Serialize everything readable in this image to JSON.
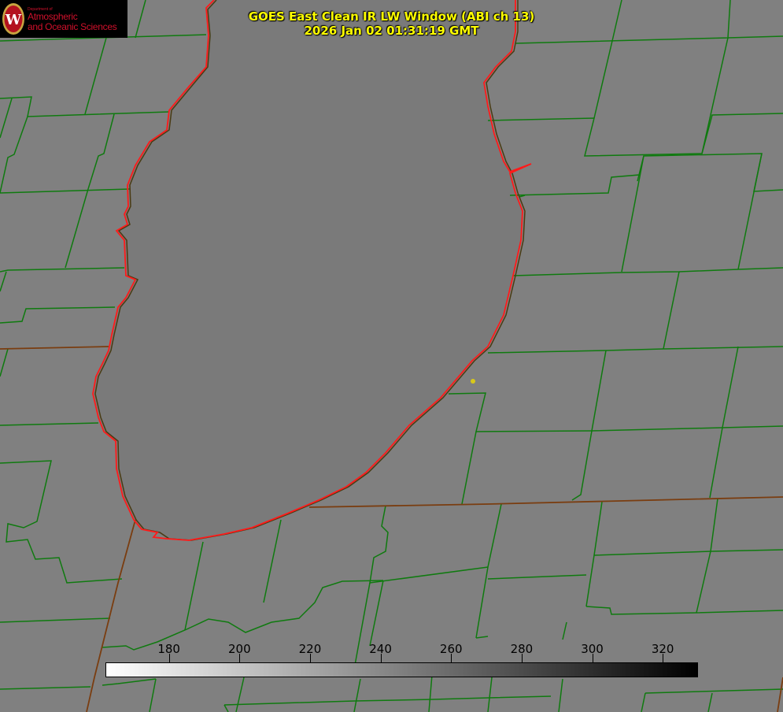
{
  "logo": {
    "dept": "Department of",
    "line1": "Atmospheric",
    "line2": "and Oceanic Sciences",
    "seal_letter": "W",
    "color": "#d0102b"
  },
  "header": {
    "title": "GOES East Clean IR LW Window (ABI ch 13)",
    "timestamp": "2026 Jan 02 01:31:19 GMT",
    "color": "#ffff00"
  },
  "colorbar": {
    "ticks": [
      "180",
      "200",
      "220",
      "240",
      "260",
      "280",
      "300",
      "320"
    ],
    "tick_values": [
      180,
      200,
      220,
      240,
      260,
      280,
      300,
      320
    ],
    "range": [
      162,
      330
    ],
    "gradient": "white-to-black"
  },
  "map": {
    "county_border_color": "#0f7a0f",
    "state_border_color": "#7a3d10",
    "shoreline_color": "#ff1a1a",
    "marker_color": "#d8c81a",
    "lake_color": "#7b7b7b",
    "land_color": "#7f7f7f"
  }
}
